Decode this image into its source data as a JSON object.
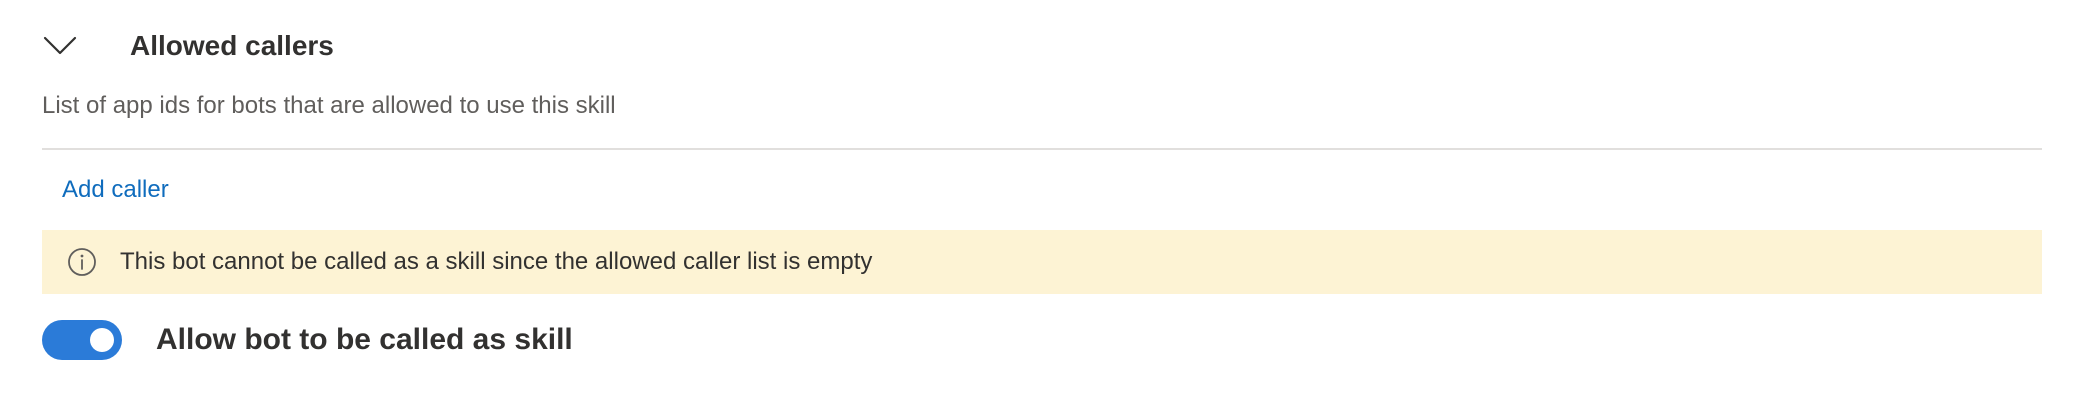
{
  "section": {
    "title": "Allowed callers",
    "description": "List of app ids for bots that are allowed to use this skill",
    "expanded": true
  },
  "actions": {
    "add_caller_label": "Add caller"
  },
  "info_banner": {
    "message": "This bot cannot be called as a skill since the allowed caller list is empty",
    "icon": "info-icon"
  },
  "toggle": {
    "label": "Allow bot to be called as skill",
    "checked": true
  },
  "colors": {
    "accent": "#0f6cbd",
    "toggle_on": "#2b7bd8",
    "warning_bg": "#fdf3d4",
    "divider": "#e1dfdd"
  }
}
